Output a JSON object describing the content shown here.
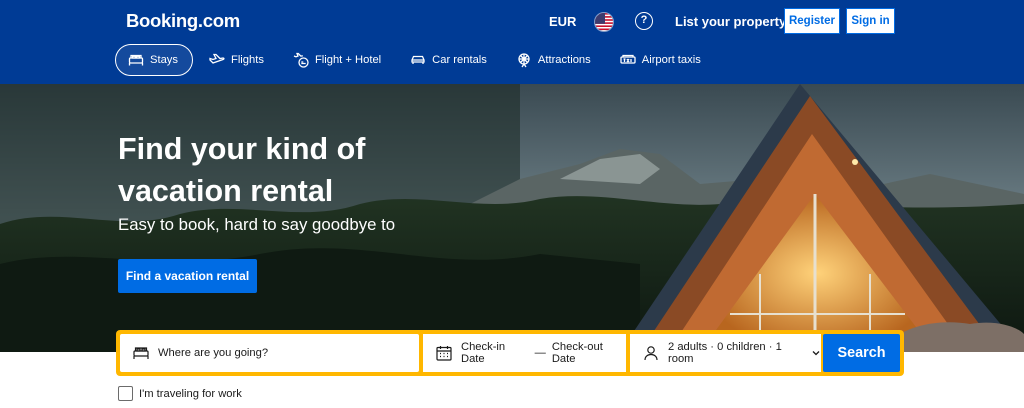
{
  "header": {
    "logo": "Booking.com",
    "currency": "EUR",
    "help": "?",
    "list_property": "List your property",
    "register": "Register",
    "sign_in": "Sign in"
  },
  "nav": [
    {
      "label": "Stays",
      "icon": "bed-icon",
      "active": true
    },
    {
      "label": "Flights",
      "icon": "plane-icon"
    },
    {
      "label": "Flight + Hotel",
      "icon": "plane-bed-icon"
    },
    {
      "label": "Car rentals",
      "icon": "car-icon"
    },
    {
      "label": "Attractions",
      "icon": "attractions-icon"
    },
    {
      "label": "Airport taxis",
      "icon": "taxi-icon"
    }
  ],
  "hero": {
    "title": "Find your kind of vacation rental",
    "subtitle": "Easy to book, hard to say goodbye to",
    "cta": "Find a vacation rental"
  },
  "search": {
    "destination_placeholder": "Where are you going?",
    "check_in": "Check-in Date",
    "separator": "—",
    "check_out": "Check-out Date",
    "occupancy": "2 adults · 0 children · 1 room",
    "button": "Search"
  },
  "work_travel": "I'm traveling for work",
  "colors": {
    "brand_blue": "#003b95",
    "action_blue": "#006ce4",
    "search_border": "#ffb700"
  }
}
